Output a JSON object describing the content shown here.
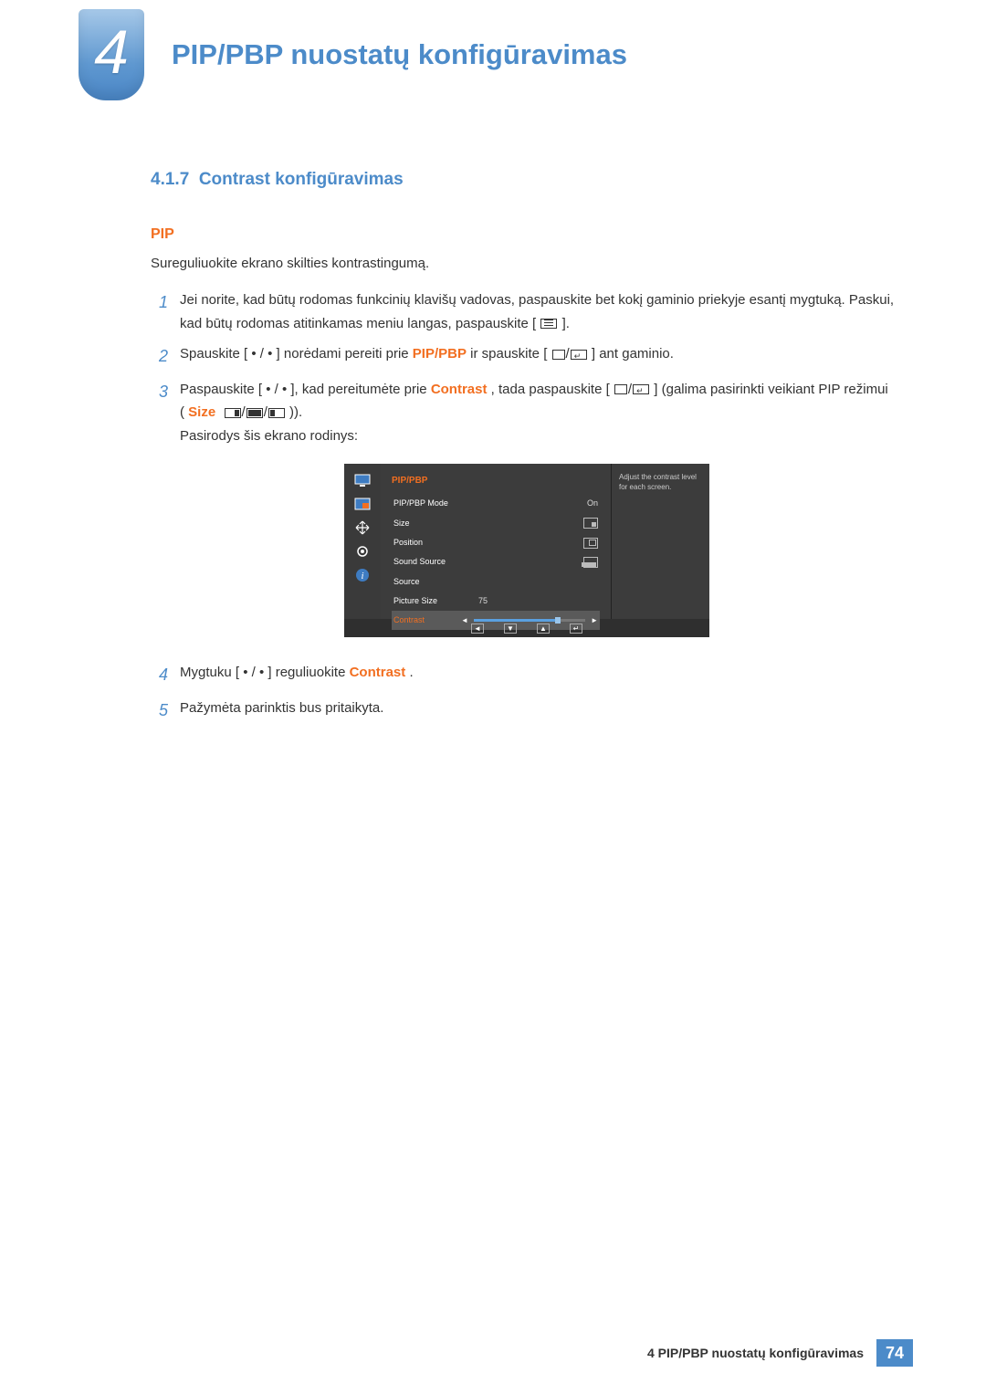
{
  "chapter": {
    "number": "4",
    "title": "PIP/PBP nuostatų konfigūravimas"
  },
  "section": {
    "number": "4.1.7",
    "title": "Contrast konfigūravimas"
  },
  "sub": "PIP",
  "intro": "Sureguliuokite ekrano skilties kontrastingumą.",
  "steps": {
    "s1": {
      "n": "1",
      "a": "Jei norite, kad būtų rodomas funkcinių klavišų vadovas, paspauskite bet kokį gaminio priekyje esantį mygtuką. Paskui, kad būtų rodomas atitinkamas meniu langas, paspauskite [",
      "b": "]."
    },
    "s2": {
      "n": "2",
      "a": "Spauskite [ • / • ] norėdami pereiti prie ",
      "hl": "PIP/PBP",
      "b": " ir spauskite [",
      "c": "] ant gaminio."
    },
    "s3": {
      "n": "3",
      "a": "Paspauskite [ • / • ], kad pereitumėte prie ",
      "hl1": "Contrast",
      "b": ", tada paspauskite [",
      "c": "] (galima pasirinkti veikiant PIP režimui (",
      "hl2": "Size",
      "d": ")).",
      "e": "Pasirodys šis ekrano rodinys:"
    },
    "s4": {
      "n": "4",
      "a": "Mygtuku [ • / • ] reguliuokite ",
      "hl": "Contrast",
      "b": "."
    },
    "s5": {
      "n": "5",
      "a": "Pažymėta parinktis bus pritaikyta."
    }
  },
  "osd": {
    "title": "PIP/PBP",
    "rows": {
      "mode": {
        "label": "PIP/PBP Mode",
        "value": "On"
      },
      "size": {
        "label": "Size"
      },
      "position": {
        "label": "Position"
      },
      "sound": {
        "label": "Sound Source"
      },
      "source": {
        "label": "Source"
      },
      "picsize": {
        "label": "Picture Size",
        "value": "75"
      },
      "contrast": {
        "label": "Contrast"
      }
    },
    "help": "Adjust the contrast level for each screen."
  },
  "footer": {
    "text": "4 PIP/PBP nuostatų konfigūravimas",
    "page": "74"
  }
}
